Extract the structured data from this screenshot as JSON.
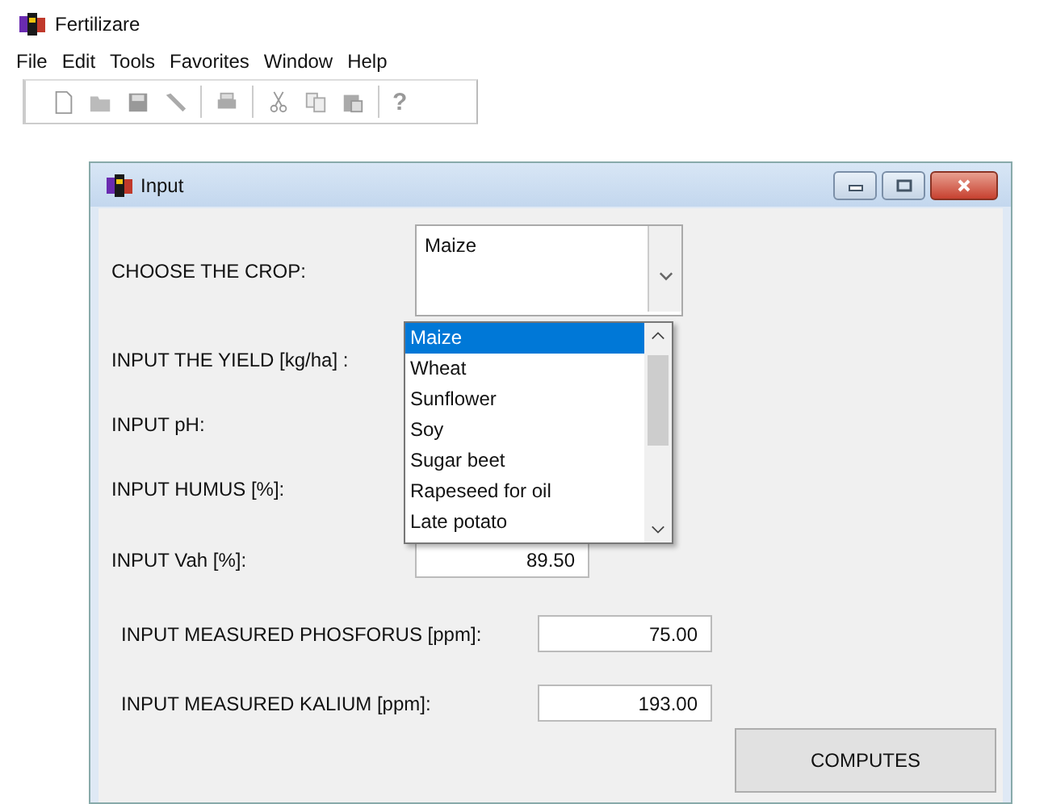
{
  "app": {
    "title": "Fertilizare"
  },
  "menu": [
    "File",
    "Edit",
    "Tools",
    "Favorites",
    "Window",
    "Help"
  ],
  "toolbar": {
    "help_glyph": "?"
  },
  "window": {
    "title": "Input"
  },
  "crop": {
    "label": "CHOOSE THE CROP:",
    "value": "Maize",
    "options": [
      {
        "label": "Maize",
        "selected": true
      },
      {
        "label": "Wheat",
        "selected": false
      },
      {
        "label": "Sunflower",
        "selected": false
      },
      {
        "label": "Soy",
        "selected": false
      },
      {
        "label": "Sugar beet",
        "selected": false
      },
      {
        "label": "Rapeseed for oil",
        "selected": false
      },
      {
        "label": "Late potato",
        "selected": false
      }
    ]
  },
  "hidden_labels": [
    "INPUT THE YIELD [kg/ha] :",
    "INPUT pH:",
    "INPUT HUMUS [%]:"
  ],
  "fields": [
    {
      "label": "INPUT Vah [%]:",
      "value": "89.50"
    },
    {
      "label": "INPUT MEASURED PHOSFORUS [ppm]:",
      "value": "75.00"
    },
    {
      "label": "INPUT MEASURED KALIUM [ppm]:",
      "value": "193.00"
    }
  ],
  "button": "COMPUTES"
}
